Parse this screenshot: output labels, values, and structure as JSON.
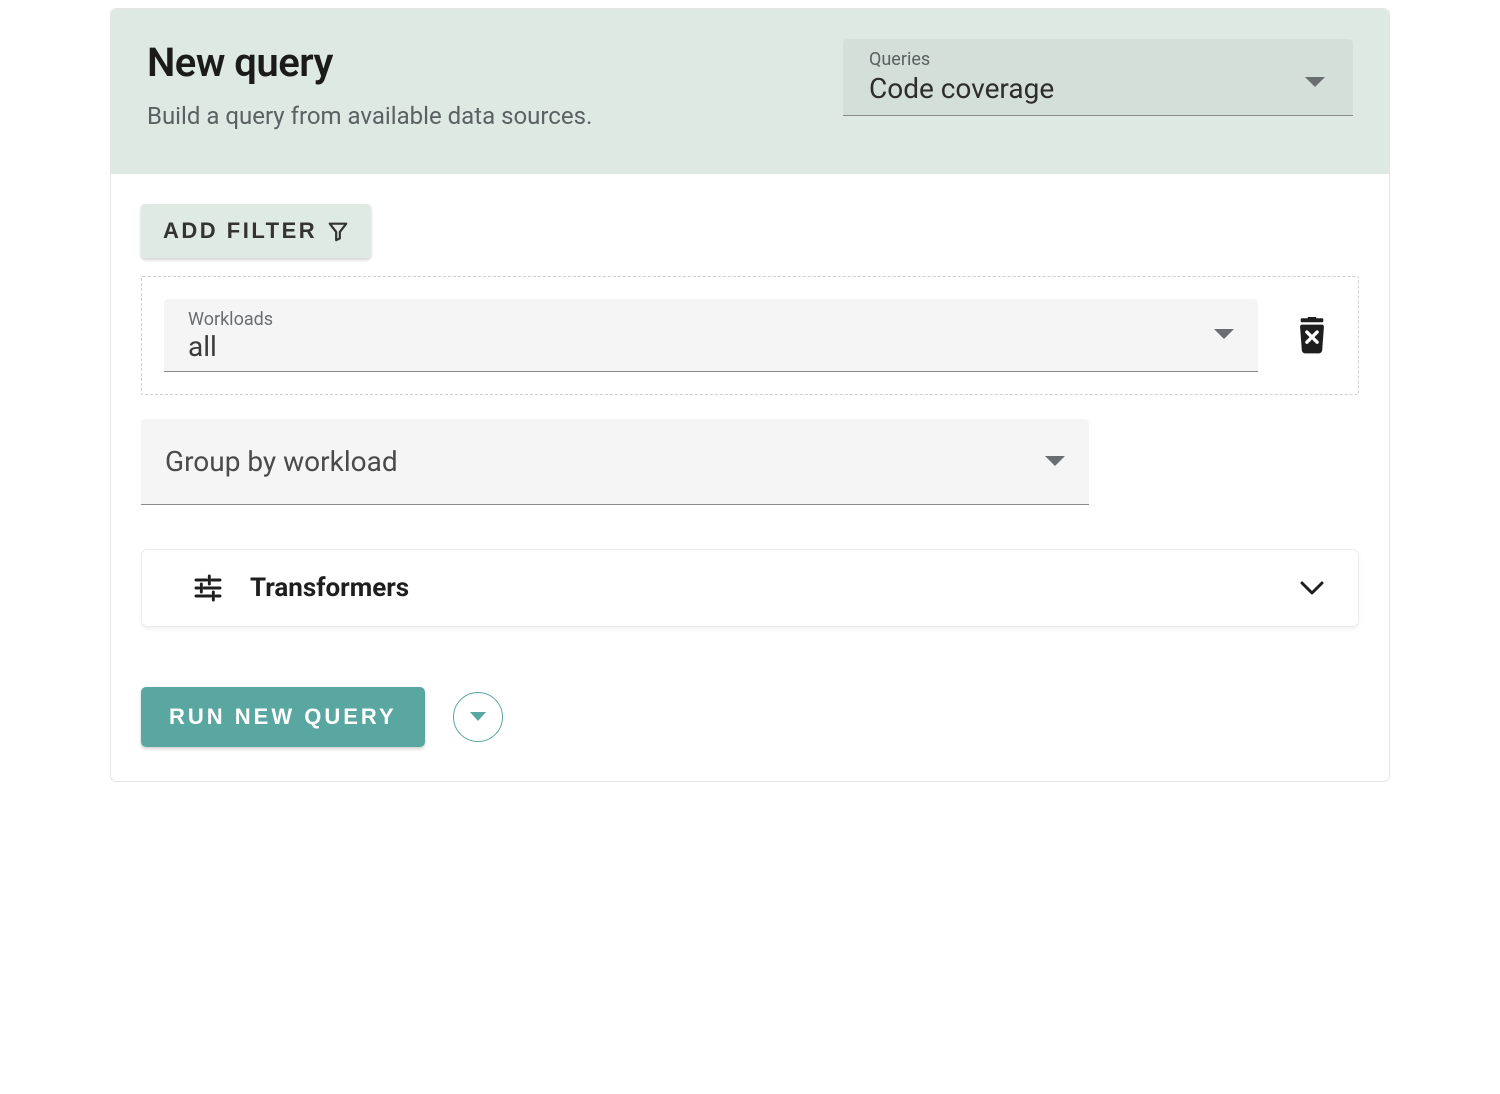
{
  "header": {
    "title": "New query",
    "subtitle": "Build a query from available data sources.",
    "queries_select": {
      "label": "Queries",
      "value": "Code coverage"
    }
  },
  "toolbar": {
    "add_filter_label": "ADD FILTER"
  },
  "filter": {
    "workloads": {
      "label": "Workloads",
      "value": "all"
    }
  },
  "groupby": {
    "value": "Group by workload"
  },
  "transformers": {
    "label": "Transformers"
  },
  "footer": {
    "run_label": "RUN NEW QUERY"
  }
}
